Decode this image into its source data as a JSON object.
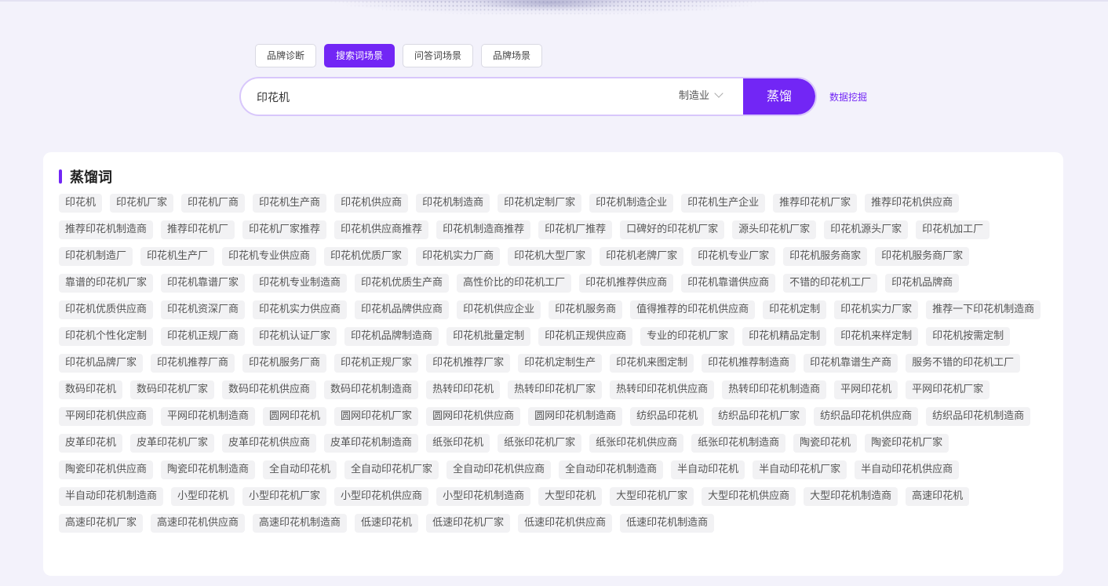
{
  "tabs": [
    {
      "label": "品牌诊断",
      "active": false
    },
    {
      "label": "搜索词场景",
      "active": true
    },
    {
      "label": "问答词场景",
      "active": false
    },
    {
      "label": "品牌场景",
      "active": false
    }
  ],
  "search": {
    "value": "印花机",
    "industry": "制造业",
    "button_label": "蒸馏",
    "link_label": "数据挖掘"
  },
  "result": {
    "title": "蒸馏词",
    "keywords": [
      "印花机",
      "印花机厂家",
      "印花机厂商",
      "印花机生产商",
      "印花机供应商",
      "印花机制造商",
      "印花机定制厂家",
      "印花机制造企业",
      "印花机生产企业",
      "推荐印花机厂家",
      "推荐印花机供应商",
      "推荐印花机制造商",
      "推荐印花机厂",
      "印花机厂家推荐",
      "印花机供应商推荐",
      "印花机制造商推荐",
      "印花机厂推荐",
      "口碑好的印花机厂家",
      "源头印花机厂家",
      "印花机源头厂家",
      "印花机加工厂",
      "印花机制造厂",
      "印花机生产厂",
      "印花机专业供应商",
      "印花机优质厂家",
      "印花机实力厂商",
      "印花机大型厂家",
      "印花机老牌厂家",
      "印花机专业厂家",
      "印花机服务商家",
      "印花机服务商厂家",
      "靠谱的印花机厂家",
      "印花机靠谱厂家",
      "印花机专业制造商",
      "印花机优质生产商",
      "高性价比的印花机工厂",
      "印花机推荐供应商",
      "印花机靠谱供应商",
      "不错的印花机工厂",
      "印花机品牌商",
      "印花机优质供应商",
      "印花机资深厂商",
      "印花机实力供应商",
      "印花机品牌供应商",
      "印花机供应企业",
      "印花机服务商",
      "值得推荐的印花机供应商",
      "印花机定制",
      "印花机实力厂家",
      "推荐一下印花机制造商",
      "印花机个性化定制",
      "印花机正规厂商",
      "印花机认证厂家",
      "印花机品牌制造商",
      "印花机批量定制",
      "印花机正规供应商",
      "专业的印花机厂家",
      "印花机精品定制",
      "印花机来样定制",
      "印花机按需定制",
      "印花机品牌厂家",
      "印花机推荐厂商",
      "印花机服务厂商",
      "印花机正规厂家",
      "印花机推荐厂家",
      "印花机定制生产",
      "印花机来图定制",
      "印花机推荐制造商",
      "印花机靠谱生产商",
      "服务不错的印花机工厂",
      "数码印花机",
      "数码印花机厂家",
      "数码印花机供应商",
      "数码印花机制造商",
      "热转印印花机",
      "热转印印花机厂家",
      "热转印印花机供应商",
      "热转印印花机制造商",
      "平网印花机",
      "平网印花机厂家",
      "平网印花机供应商",
      "平网印花机制造商",
      "圆网印花机",
      "圆网印花机厂家",
      "圆网印花机供应商",
      "圆网印花机制造商",
      "纺织品印花机",
      "纺织品印花机厂家",
      "纺织品印花机供应商",
      "纺织品印花机制造商",
      "皮革印花机",
      "皮革印花机厂家",
      "皮革印花机供应商",
      "皮革印花机制造商",
      "纸张印花机",
      "纸张印花机厂家",
      "纸张印花机供应商",
      "纸张印花机制造商",
      "陶瓷印花机",
      "陶瓷印花机厂家",
      "陶瓷印花机供应商",
      "陶瓷印花机制造商",
      "全自动印花机",
      "全自动印花机厂家",
      "全自动印花机供应商",
      "全自动印花机制造商",
      "半自动印花机",
      "半自动印花机厂家",
      "半自动印花机供应商",
      "半自动印花机制造商",
      "小型印花机",
      "小型印花机厂家",
      "小型印花机供应商",
      "小型印花机制造商",
      "大型印花机",
      "大型印花机厂家",
      "大型印花机供应商",
      "大型印花机制造商",
      "高速印花机",
      "高速印花机厂家",
      "高速印花机供应商",
      "高速印花机制造商",
      "低速印花机",
      "低速印花机厂家",
      "低速印花机供应商",
      "低速印花机制造商"
    ]
  },
  "colors": {
    "accent": "#7226f5",
    "tag_bg": "#f2f2f4",
    "page_bg": "#f3f2fb"
  }
}
